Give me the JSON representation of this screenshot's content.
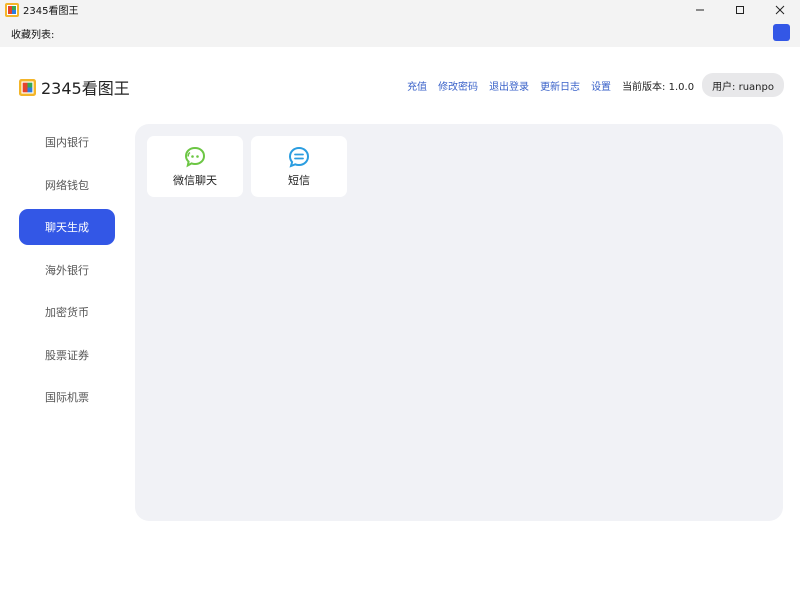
{
  "window": {
    "title": "2345看图王",
    "controls": [
      "minimize-icon",
      "maximize-icon",
      "close-icon"
    ]
  },
  "favorites": {
    "label": "收藏列表:"
  },
  "header": {
    "logo_text": "2345看图王",
    "links": [
      "充值",
      "修改密码",
      "退出登录",
      "更新日志",
      "设置"
    ],
    "version": "当前版本: 1.0.0",
    "user": "用户: ruanpo"
  },
  "sidebar": {
    "items": [
      {
        "label": "国内银行",
        "active": false
      },
      {
        "label": "网络钱包",
        "active": false
      },
      {
        "label": "聊天生成",
        "active": true
      },
      {
        "label": "海外银行",
        "active": false
      },
      {
        "label": "加密货币",
        "active": false
      },
      {
        "label": "股票证券",
        "active": false
      },
      {
        "label": "国际机票",
        "active": false
      }
    ]
  },
  "main": {
    "cards": [
      {
        "label": "微信聊天",
        "icon": "wechat-icon"
      },
      {
        "label": "短信",
        "icon": "sms-icon"
      }
    ]
  },
  "colors": {
    "accent": "#3357e6",
    "link": "#3a62c9",
    "panel_bg": "#f1f2f6",
    "wechat_green": "#6cc644",
    "sms_blue": "#2b9de0"
  }
}
